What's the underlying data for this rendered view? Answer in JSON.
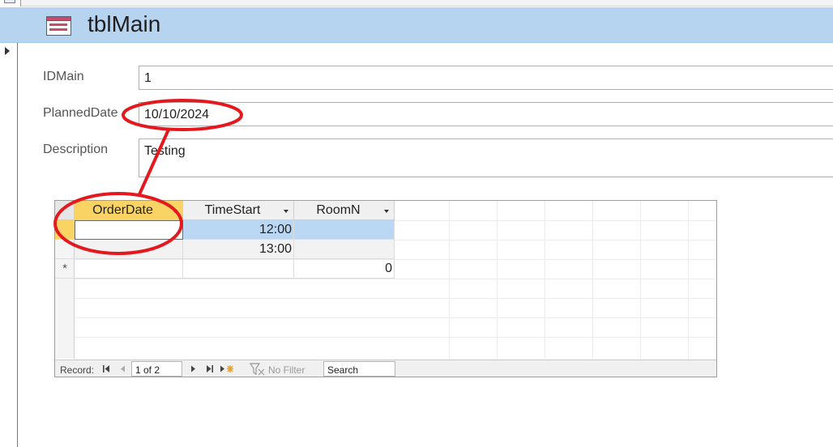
{
  "form": {
    "title": "tblMain",
    "fields": [
      {
        "label": "IDMain",
        "value": "1"
      },
      {
        "label": "PlannedDate",
        "value": "10/10/2024"
      },
      {
        "label": "Description",
        "value": "Testing"
      }
    ]
  },
  "subform": {
    "columns": [
      "OrderDate",
      "TimeStart",
      "RoomN"
    ],
    "rows": [
      {
        "OrderDate": "",
        "TimeStart": "12:00",
        "RoomN": ""
      },
      {
        "OrderDate": "",
        "TimeStart": "13:00",
        "RoomN": ""
      }
    ],
    "new_row": {
      "marker": "*",
      "RoomN": "0"
    }
  },
  "navigation": {
    "record_label": "Record:",
    "position": "1 of 2",
    "filter": "No Filter",
    "search_placeholder": "Search"
  },
  "annotation": {
    "color": "#e3191f"
  }
}
